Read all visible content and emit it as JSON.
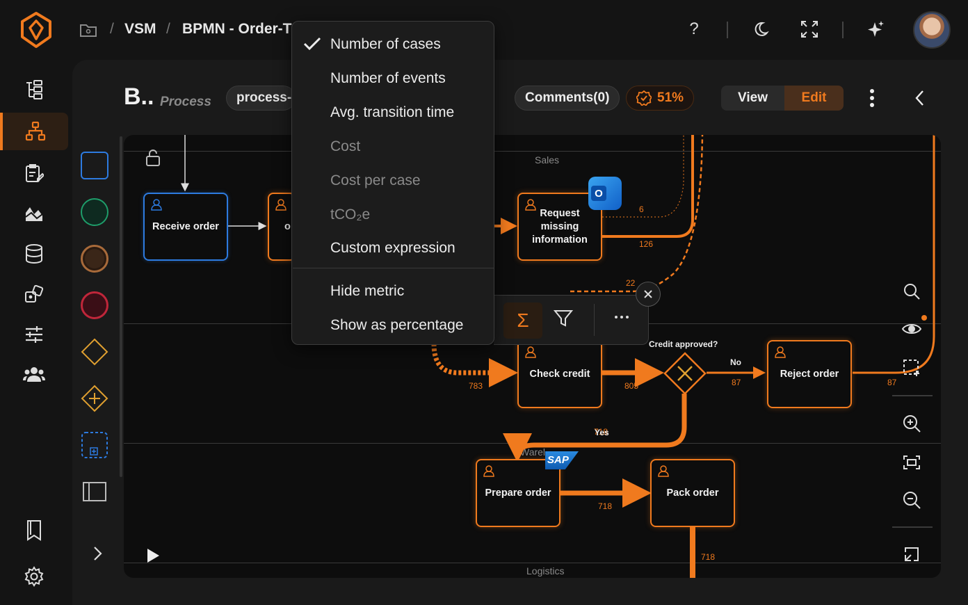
{
  "breadcrumb": {
    "items": [
      "VSM",
      "BPMN - Order-T"
    ]
  },
  "process": {
    "title": "B..",
    "subtitle": "Process",
    "tag": "process-",
    "comments": "Comments(0)",
    "score": "51%"
  },
  "mode": {
    "view": "View",
    "edit": "Edit",
    "active": "Edit"
  },
  "lanes": {
    "sales": "Sales",
    "warehouse": "Warel",
    "logistics": "Logistics"
  },
  "tasks": {
    "receive_order": "Receive order",
    "partial": "o",
    "request_missing": "Request missing information",
    "check_credit": "Check credit",
    "reject_order": "Reject order",
    "prepare_order": "Prepare order",
    "pack_order": "Pack order"
  },
  "gateway": {
    "label": "Credit approved?",
    "no": "No",
    "yes": "Yes"
  },
  "flows": {
    "f6": "6",
    "f126": "126",
    "f22": "22",
    "f783": "783",
    "f805": "805",
    "f87": "87",
    "f87b": "87",
    "f718a": "718",
    "f718b": "718",
    "f718c": "718"
  },
  "badges": {
    "outlook": "O",
    "sap": "SAP"
  },
  "metric_menu": {
    "items": [
      {
        "label": "Number of cases",
        "checked": true,
        "enabled": true
      },
      {
        "label": "Number of events",
        "checked": false,
        "enabled": true
      },
      {
        "label": "Avg. transition time",
        "checked": false,
        "enabled": true
      },
      {
        "label": "Cost",
        "checked": false,
        "enabled": false
      },
      {
        "label": "Cost per case",
        "checked": false,
        "enabled": false
      },
      {
        "label": "tCO₂e",
        "checked": false,
        "enabled": false
      },
      {
        "label": "Custom expression",
        "checked": false,
        "enabled": true
      }
    ],
    "actions": [
      "Hide metric",
      "Show as percentage"
    ]
  },
  "colors": {
    "accent": "#f07a1e",
    "task_border": "#f07a1e",
    "start_border": "#2d7be0",
    "bg": "#141414"
  }
}
